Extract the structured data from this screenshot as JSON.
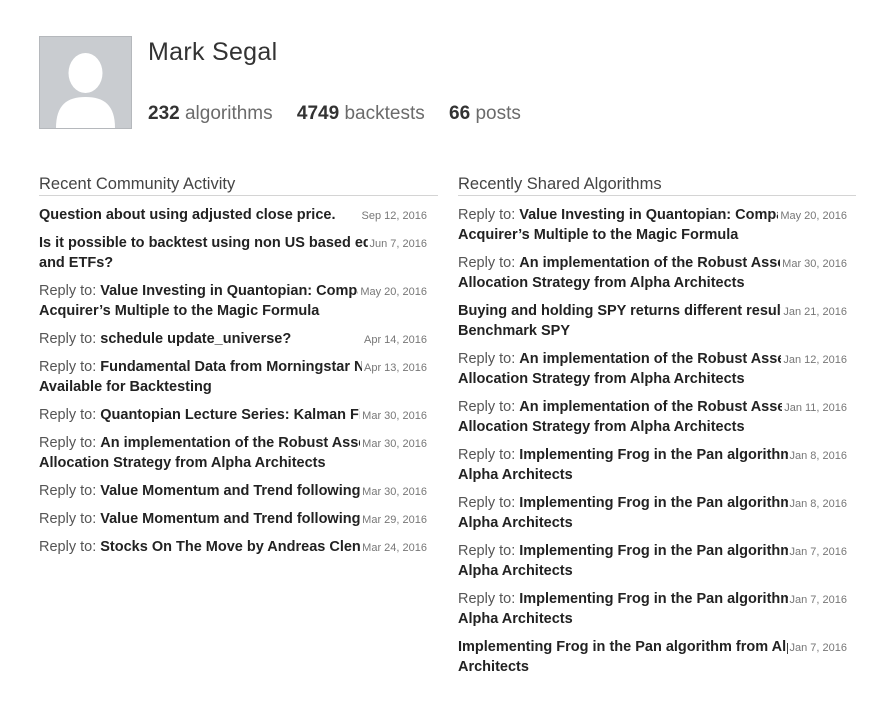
{
  "profile": {
    "name": "Mark Segal",
    "stats": [
      {
        "count": "232",
        "label": "algorithms"
      },
      {
        "count": "4749",
        "label": "backtests"
      },
      {
        "count": "66",
        "label": "posts"
      }
    ],
    "avatar_icon": "default-user-silhouette",
    "avatar_bg": "#c9ccd0"
  },
  "community": {
    "title": "Recent Community Activity",
    "items": [
      {
        "prefix": "",
        "title": "Question about using adjusted close price.",
        "date": "Sep 12, 2016"
      },
      {
        "prefix": "",
        "title": "Is it possible to backtest using non US based equities and ETFs?",
        "date": "Jun 7, 2016"
      },
      {
        "prefix": "Reply to: ",
        "title": "Value Investing in Quantopian: Comparing the Acquirer’s Multiple to the Magic Formula",
        "date": "May 20, 2016"
      },
      {
        "prefix": "Reply to: ",
        "title": "schedule update_universe?",
        "date": "Apr 14, 2016"
      },
      {
        "prefix": "Reply to: ",
        "title": "Fundamental Data from Morningstar Now Available for Backtesting",
        "date": "Apr 13, 2016"
      },
      {
        "prefix": "Reply to: ",
        "title": "Quantopian Lecture Series: Kalman Filters",
        "date": "Mar 30, 2016"
      },
      {
        "prefix": "Reply to: ",
        "title": "An implementation of the Robust Asset Allocation Strategy from Alpha Architects",
        "date": "Mar 30, 2016"
      },
      {
        "prefix": "Reply to: ",
        "title": "Value Momentum and Trend following",
        "date": "Mar 30, 2016"
      },
      {
        "prefix": "Reply to: ",
        "title": "Value Momentum and Trend following",
        "date": "Mar 29, 2016"
      },
      {
        "prefix": "Reply to: ",
        "title": "Stocks On The Move by Andreas Clenow",
        "date": "Mar 24, 2016"
      }
    ]
  },
  "shared": {
    "title": "Recently Shared Algorithms",
    "items": [
      {
        "prefix": "Reply to: ",
        "title": "Value Investing in Quantopian: Comparing the Acquirer’s Multiple to the Magic Formula",
        "date": "May 20, 2016"
      },
      {
        "prefix": "Reply to: ",
        "title": "An implementation of the Robust Asset Allocation Strategy from Alpha Architects",
        "date": "Mar 30, 2016"
      },
      {
        "prefix": "",
        "title": "Buying and holding SPY returns different results from Benchmark SPY",
        "date": "Jan 21, 2016"
      },
      {
        "prefix": "Reply to: ",
        "title": "An implementation of the Robust Asset Allocation Strategy from Alpha Architects",
        "date": "Jan 12, 2016"
      },
      {
        "prefix": "Reply to: ",
        "title": "An implementation of the Robust Asset Allocation Strategy from Alpha Architects",
        "date": "Jan 11, 2016"
      },
      {
        "prefix": "Reply to: ",
        "title": "Implementing Frog in the Pan algorithm from Alpha Architects",
        "date": "Jan 8, 2016"
      },
      {
        "prefix": "Reply to: ",
        "title": "Implementing Frog in the Pan algorithm from Alpha Architects",
        "date": "Jan 8, 2016"
      },
      {
        "prefix": "Reply to: ",
        "title": "Implementing Frog in the Pan algorithm from Alpha Architects",
        "date": "Jan 7, 2016"
      },
      {
        "prefix": "Reply to: ",
        "title": "Implementing Frog in the Pan algorithm from Alpha Architects",
        "date": "Jan 7, 2016"
      },
      {
        "prefix": "",
        "title": "Implementing Frog in the Pan algorithm from Alpha Architects",
        "date": "Jan 7, 2016"
      }
    ]
  }
}
